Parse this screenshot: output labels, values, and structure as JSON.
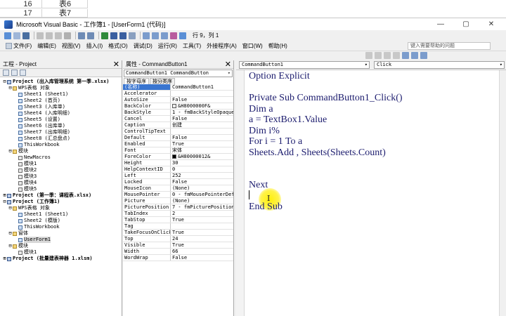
{
  "excel": {
    "rows": [
      {
        "num": "16",
        "value": "表6"
      },
      {
        "num": "17",
        "value": "表7"
      }
    ]
  },
  "window": {
    "title": "Microsoft Visual Basic - 工作簿1 - [UserForm1 (代码)]",
    "minimize": "—",
    "restore": "▢",
    "close": "✕"
  },
  "toolbar": {
    "position_text": "行 9，列 1"
  },
  "menu": {
    "items": [
      {
        "label": "文件(F)"
      },
      {
        "label": "编辑(E)"
      },
      {
        "label": "视图(V)"
      },
      {
        "label": "插入(I)"
      },
      {
        "label": "格式(O)"
      },
      {
        "label": "调试(D)"
      },
      {
        "label": "运行(R)"
      },
      {
        "label": "工具(T)"
      },
      {
        "label": "外接程序(A)"
      },
      {
        "label": "窗口(W)"
      },
      {
        "label": "帮助(H)"
      }
    ],
    "help_placeholder": "键入需要帮助的问题"
  },
  "project": {
    "title": "工程 - Project",
    "close": "✕",
    "tree": [
      {
        "label": "Project (出入库管理系统 第一季.xlsx)",
        "kind": "proj",
        "indent": 0,
        "exp": "⊟",
        "bold": true
      },
      {
        "label": "WPS表格 对象",
        "kind": "folder",
        "indent": 1,
        "exp": "⊟"
      },
      {
        "label": "Sheet1 (Sheet1)",
        "kind": "form",
        "indent": 2,
        "exp": ""
      },
      {
        "label": "Sheet2 (首页)",
        "kind": "form",
        "indent": 2,
        "exp": ""
      },
      {
        "label": "Sheet3 (入库单)",
        "kind": "form",
        "indent": 2,
        "exp": ""
      },
      {
        "label": "Sheet4 (入库明细)",
        "kind": "form",
        "indent": 2,
        "exp": ""
      },
      {
        "label": "Sheet5 (设置)",
        "kind": "form",
        "indent": 2,
        "exp": ""
      },
      {
        "label": "Sheet6 (出库单)",
        "kind": "form",
        "indent": 2,
        "exp": ""
      },
      {
        "label": "Sheet7 (出库明细)",
        "kind": "form",
        "indent": 2,
        "exp": ""
      },
      {
        "label": "Sheet8 (汇总盘点)",
        "kind": "form",
        "indent": 2,
        "exp": ""
      },
      {
        "label": "ThisWorkbook",
        "kind": "form",
        "indent": 2,
        "exp": ""
      },
      {
        "label": "模块",
        "kind": "folder",
        "indent": 1,
        "exp": "⊟"
      },
      {
        "label": "NewMacros",
        "kind": "module",
        "indent": 2,
        "exp": ""
      },
      {
        "label": "模块1",
        "kind": "module",
        "indent": 2,
        "exp": ""
      },
      {
        "label": "模块2",
        "kind": "module",
        "indent": 2,
        "exp": ""
      },
      {
        "label": "模块3",
        "kind": "module",
        "indent": 2,
        "exp": ""
      },
      {
        "label": "模块4",
        "kind": "module",
        "indent": 2,
        "exp": ""
      },
      {
        "label": "模块5",
        "kind": "module",
        "indent": 2,
        "exp": ""
      },
      {
        "label": "Project (第一季：课程表.xlsx)",
        "kind": "proj",
        "indent": 0,
        "exp": "⊞",
        "bold": true
      },
      {
        "label": "Project (工作簿1)",
        "kind": "proj",
        "indent": 0,
        "exp": "⊟",
        "bold": true
      },
      {
        "label": "WPS表格 对象",
        "kind": "folder",
        "indent": 1,
        "exp": "⊟"
      },
      {
        "label": "Sheet1 (Sheet1)",
        "kind": "form",
        "indent": 2,
        "exp": ""
      },
      {
        "label": "Sheet2 (模版)",
        "kind": "form",
        "indent": 2,
        "exp": ""
      },
      {
        "label": "ThisWorkbook",
        "kind": "form",
        "indent": 2,
        "exp": ""
      },
      {
        "label": "窗体",
        "kind": "folder",
        "indent": 1,
        "exp": "⊟"
      },
      {
        "label": "UserForm1",
        "kind": "form",
        "indent": 2,
        "exp": "",
        "selected": true
      },
      {
        "label": "模块",
        "kind": "folder",
        "indent": 1,
        "exp": "⊟"
      },
      {
        "label": "模块1",
        "kind": "module",
        "indent": 2,
        "exp": ""
      },
      {
        "label": "Project (批量建表神器 1.xlsm)",
        "kind": "proj",
        "indent": 0,
        "exp": "⊞",
        "bold": true
      }
    ]
  },
  "properties": {
    "title": "属性 - CommandButton1",
    "close": "✕",
    "object": "CommandButton1 CommandButton",
    "tabs": [
      "按字母序",
      "按分类序"
    ],
    "rows": [
      {
        "name": "(名称)",
        "value": "CommandButton1",
        "selected": true
      },
      {
        "name": "Accelerator",
        "value": ""
      },
      {
        "name": "AutoSize",
        "value": "False"
      },
      {
        "name": "BackColor",
        "value": "&H8000000F&",
        "swatch": "#ececec"
      },
      {
        "name": "BackStyle",
        "value": "1 - fmBackStyleOpaque"
      },
      {
        "name": "Cancel",
        "value": "False"
      },
      {
        "name": "Caption",
        "value": "创建"
      },
      {
        "name": "ControlTipText",
        "value": ""
      },
      {
        "name": "Default",
        "value": "False"
      },
      {
        "name": "Enabled",
        "value": "True"
      },
      {
        "name": "Font",
        "value": "宋体"
      },
      {
        "name": "ForeColor",
        "value": "&H80000012&",
        "swatch": "#000000"
      },
      {
        "name": "Height",
        "value": "30"
      },
      {
        "name": "HelpContextID",
        "value": "0"
      },
      {
        "name": "Left",
        "value": "252"
      },
      {
        "name": "Locked",
        "value": "False"
      },
      {
        "name": "MouseIcon",
        "value": "(None)"
      },
      {
        "name": "MousePointer",
        "value": "0 - fmMousePointerDef"
      },
      {
        "name": "Picture",
        "value": "(None)"
      },
      {
        "name": "PicturePosition",
        "value": "7 - fmPicturePosition"
      },
      {
        "name": "TabIndex",
        "value": "2"
      },
      {
        "name": "TabStop",
        "value": "True"
      },
      {
        "name": "Tag",
        "value": ""
      },
      {
        "name": "TakeFocusOnClick",
        "value": "True"
      },
      {
        "name": "Top",
        "value": "24"
      },
      {
        "name": "Visible",
        "value": "True"
      },
      {
        "name": "Width",
        "value": "66"
      },
      {
        "name": "WordWrap",
        "value": "False"
      }
    ]
  },
  "code": {
    "object_combo": "CommandButton1",
    "proc_combo": "Click",
    "lines": [
      {
        "text": "Option Explicit",
        "line": 0
      },
      {
        "text": "Private Sub CommandButton1_Click()",
        "line": 2
      },
      {
        "text": "Dim a",
        "line": 3
      },
      {
        "text": "a = TextBox1.Value",
        "line": 4
      },
      {
        "text": "Dim i%",
        "line": 5
      },
      {
        "text": "For i = 1 To a",
        "line": 6
      },
      {
        "text": "Sheets.Add , Sheets(Sheets.Count)",
        "line": 7
      },
      {
        "text": "Next",
        "line": 10
      },
      {
        "text": "End Sub",
        "line": 12
      }
    ],
    "cursor_glyph": "I"
  },
  "colors": {
    "code_text": "#1c1c6e",
    "selection": "#3975d0",
    "highlight": "#ffee00"
  }
}
